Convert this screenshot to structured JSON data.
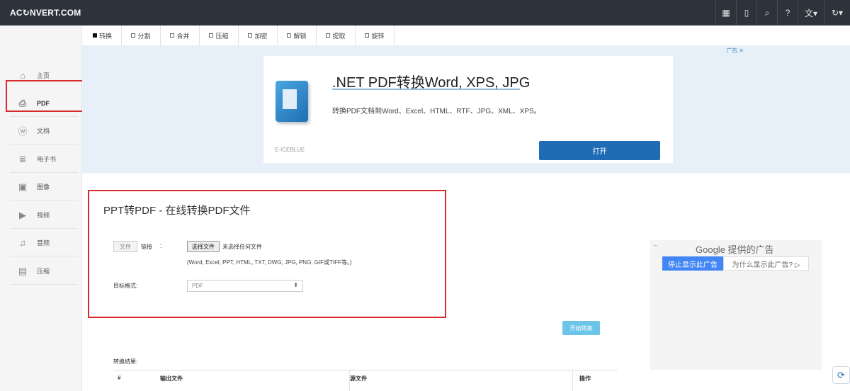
{
  "header": {
    "logo": "AC↻NVERT.COM",
    "icons": [
      {
        "name": "grid-icon",
        "glyph": "▦"
      },
      {
        "name": "mobile-icon",
        "glyph": "▯"
      },
      {
        "name": "search-icon",
        "glyph": "⌕"
      },
      {
        "name": "help-icon",
        "glyph": "?"
      },
      {
        "name": "language-icon",
        "glyph": "文▾"
      },
      {
        "name": "refresh-icon",
        "glyph": "↻▾"
      }
    ]
  },
  "sidebar": {
    "items": [
      {
        "label": "主页",
        "icon": "home-icon",
        "glyph": "⌂"
      },
      {
        "label": "PDF",
        "icon": "pdf-file-icon",
        "glyph": "⎙"
      },
      {
        "label": "文档",
        "icon": "word-file-icon",
        "glyph": "ⓦ"
      },
      {
        "label": "电子书",
        "icon": "ebook-file-icon",
        "glyph": "≣"
      },
      {
        "label": "图像",
        "icon": "image-file-icon",
        "glyph": "▣"
      },
      {
        "label": "视频",
        "icon": "video-file-icon",
        "glyph": "▶"
      },
      {
        "label": "音频",
        "icon": "audio-file-icon",
        "glyph": "♫"
      },
      {
        "label": "压缩",
        "icon": "archive-file-icon",
        "glyph": "▤"
      }
    ]
  },
  "tabs": [
    {
      "label": "转换",
      "active": true
    },
    {
      "label": "分割",
      "active": false
    },
    {
      "label": "合并",
      "active": false
    },
    {
      "label": "压缩",
      "active": false
    },
    {
      "label": "加密",
      "active": false
    },
    {
      "label": "解锁",
      "active": false
    },
    {
      "label": "提取",
      "active": false
    },
    {
      "label": "旋转",
      "active": false
    }
  ],
  "ad": {
    "mark": "广告 ✕",
    "title": ".NET PDF转换Word, XPS, JPG",
    "desc": "转换PDF文档到Word、Excel、HTML、RTF、JPG、XML、XPS。",
    "brand": "E-ICEBLUE",
    "button": "打开"
  },
  "form": {
    "title": "PPT转PDF - 在线转换PDF文件",
    "file_tab": "文件",
    "link_tab": "链接",
    "colon": ":",
    "choose_file": "选择文件",
    "no_file": "未选择任何文件",
    "formats": "(Word, Excel, PPT, HTML, TXT, DWG, JPG, PNG, GIF或TIFF等。)",
    "target_label": "目标格式:",
    "target_value": "PDF",
    "start_button": "开始转换"
  },
  "result": {
    "label": "转换结果:",
    "columns": [
      "#",
      "输出文件",
      "源文件",
      "操作"
    ]
  },
  "google_ad": {
    "back": "←",
    "title": "Google 提供的广告",
    "stop": "停止显示此广告",
    "why": "为什么显示此广告? ▷"
  },
  "float_button": "⟳",
  "colors": {
    "topbar": "#2d333b",
    "highlight": "#d52b2b",
    "primary": "#1f6bb4",
    "start": "#6cc4e8",
    "google": "#4285f4"
  }
}
